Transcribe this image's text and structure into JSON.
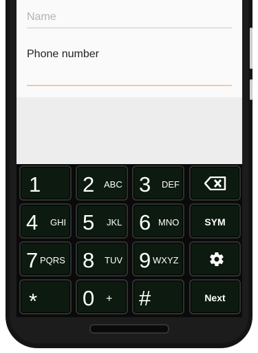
{
  "form": {
    "name_placeholder": "Name",
    "name_value": "",
    "phone_label": "Phone number",
    "phone_value": ""
  },
  "keyboard": {
    "keys": [
      {
        "num": "1",
        "letters": ""
      },
      {
        "num": "2",
        "letters": "ABC"
      },
      {
        "num": "3",
        "letters": "DEF"
      },
      {
        "num": "4",
        "letters": "GHI"
      },
      {
        "num": "5",
        "letters": "JKL"
      },
      {
        "num": "6",
        "letters": "MNO"
      },
      {
        "num": "7",
        "letters": "PQRS"
      },
      {
        "num": "8",
        "letters": "TUV"
      },
      {
        "num": "9",
        "letters": "WXYZ"
      },
      {
        "num": "*",
        "letters": ""
      },
      {
        "num": "0",
        "letters": "+"
      },
      {
        "num": "#",
        "letters": ""
      }
    ],
    "backspace_icon": "backspace-icon",
    "sym_label": "SYM",
    "settings_icon": "gear-icon",
    "next_label": "Next"
  },
  "colors": {
    "key_bg": "#0d1a0f",
    "key_border": "#2f3330",
    "field_accent": "#f3c9a6",
    "form_bg": "#fafafa",
    "gray_bg": "#ededed"
  }
}
